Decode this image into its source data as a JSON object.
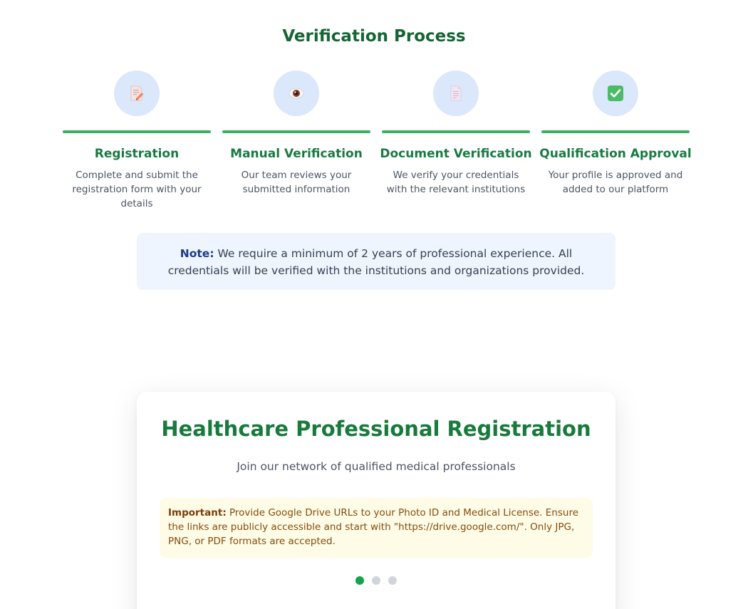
{
  "verification": {
    "title": "Verification Process",
    "steps": [
      {
        "icon": "memo-pencil-icon",
        "title": "Registration",
        "description": "Complete and submit the registration form with your details"
      },
      {
        "icon": "eye-icon",
        "title": "Manual Verification",
        "description": "Our team reviews your submitted information"
      },
      {
        "icon": "document-icon",
        "title": "Document Verification",
        "description": "We verify your credentials with the relevant institutions"
      },
      {
        "icon": "check-box-icon",
        "title": "Qualification Approval",
        "description": "Your profile is approved and added to our platform"
      }
    ],
    "note": {
      "label": "Note:",
      "text": "We require a minimum of 2 years of professional experience. All credentials will be verified with the institutions and organizations provided."
    }
  },
  "registration": {
    "title": "Healthcare Professional Registration",
    "subtitle": "Join our network of qualified medical professionals",
    "important": {
      "label": "Important:",
      "text": "Provide Google Drive URLs to your Photo ID and Medical License. Ensure the links are publicly accessible and start with \"https://drive.google.com/\". Only JPG, PNG, or PDF formats are accepted."
    },
    "progress": {
      "current_step": 1,
      "total_steps": 3
    }
  },
  "colors": {
    "primary_green": "#16a34a",
    "heading_green": "#166534",
    "note_bg": "#eef5ff",
    "important_bg": "#fefbe6"
  }
}
